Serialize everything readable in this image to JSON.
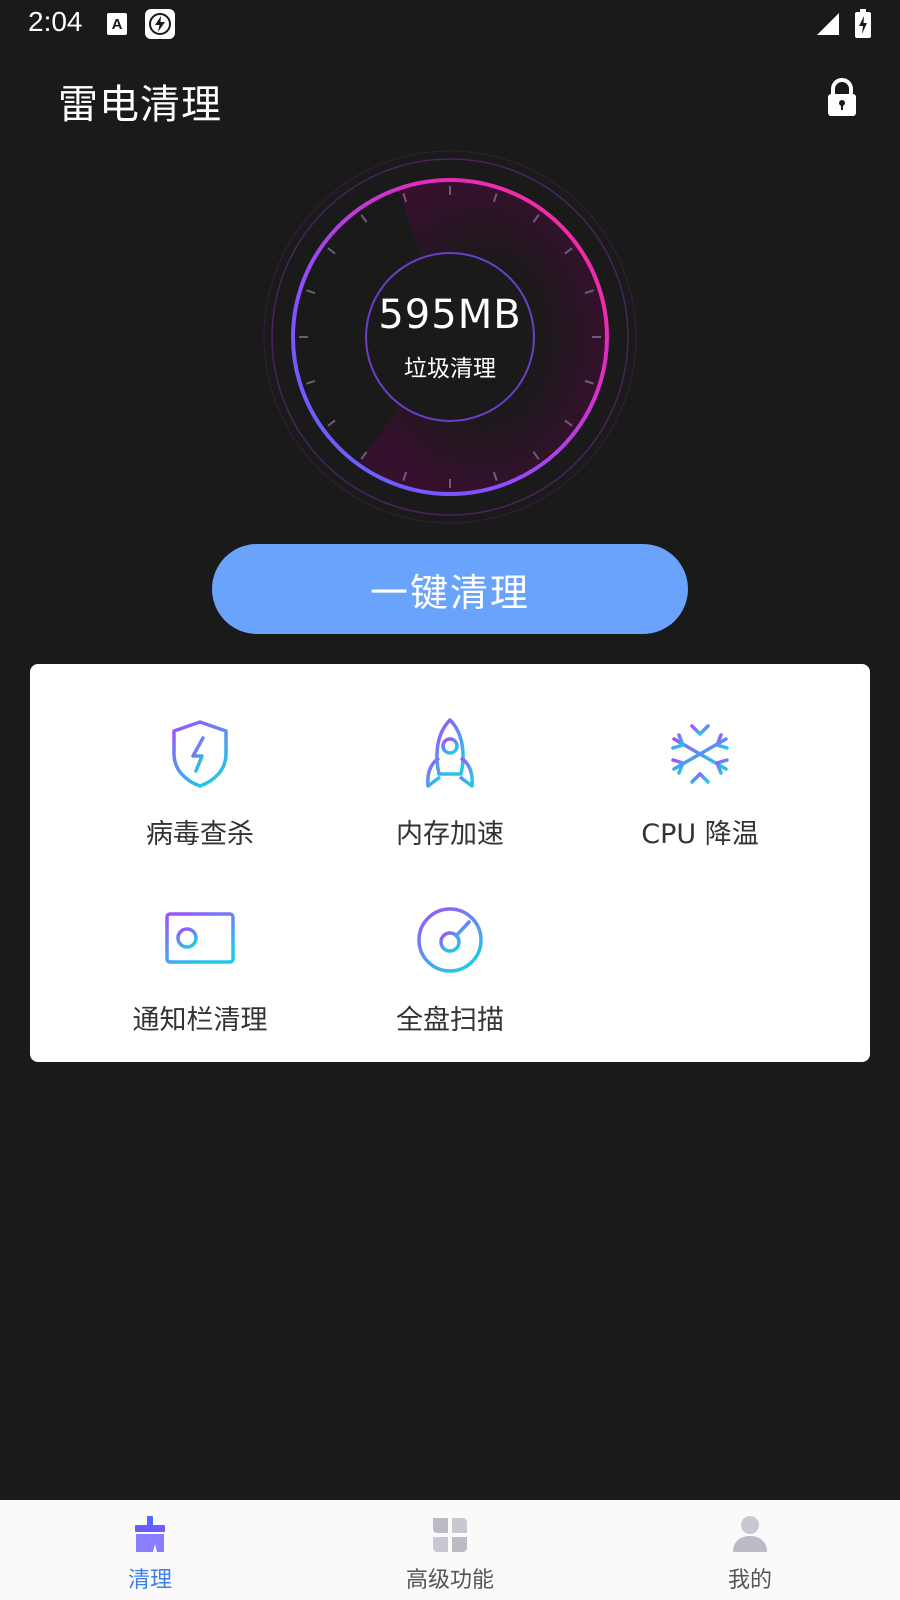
{
  "status_bar": {
    "time": "2:04",
    "icons": [
      "a-notification-icon",
      "flash-notification-icon",
      "cellular-signal-icon",
      "battery-charging-icon"
    ]
  },
  "header": {
    "title": "雷电清理",
    "lock_icon": "lock-icon"
  },
  "gauge": {
    "value": "595MB",
    "label": "垃圾清理",
    "colors": {
      "start": "#7a5cff",
      "end": "#ff2d8f"
    }
  },
  "main_action": {
    "label": "一键清理",
    "color": "#6aa3fb"
  },
  "features": [
    {
      "label": "病毒查杀",
      "icon": "shield-bolt-icon"
    },
    {
      "label": "内存加速",
      "icon": "rocket-icon"
    },
    {
      "label": "CPU 降温",
      "icon": "snowflake-icon"
    },
    {
      "label": "通知栏清理",
      "icon": "id-card-icon"
    },
    {
      "label": "全盘扫描",
      "icon": "disk-scan-icon"
    }
  ],
  "bottom_nav": [
    {
      "label": "清理",
      "icon": "broom-icon",
      "active": true
    },
    {
      "label": "高级功能",
      "icon": "grid-icon",
      "active": false
    },
    {
      "label": "我的",
      "icon": "user-icon",
      "active": false
    }
  ],
  "colors": {
    "background": "#1a1a1a",
    "accent_blue": "#3d7ff0",
    "icon_gradient_start": "#a34dff",
    "icon_gradient_end": "#22c7e8"
  }
}
